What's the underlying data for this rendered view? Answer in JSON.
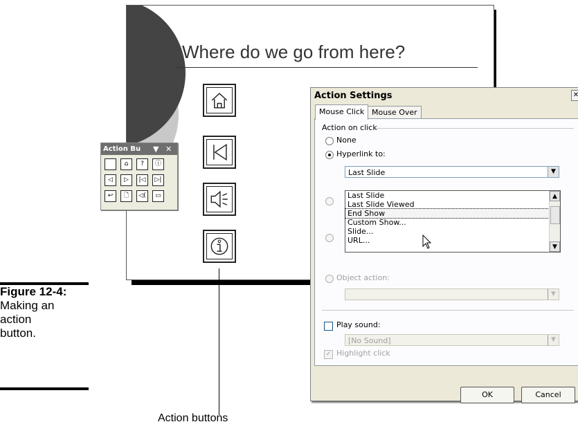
{
  "figure": {
    "number": "Figure 12-4:",
    "text": "Making an action button."
  },
  "slide": {
    "title": "Where do we go from here?",
    "buttons": [
      "home-icon",
      "beginning-icon",
      "sound-icon",
      "information-icon"
    ]
  },
  "callout": {
    "label": "Action buttons"
  },
  "toolbar": {
    "title": "Action Bu",
    "menu_glyph": "▼",
    "close_glyph": "✕",
    "buttons": [
      {
        "name": "custom-button-icon",
        "glyph": ""
      },
      {
        "name": "home-button-icon",
        "glyph": "⌂"
      },
      {
        "name": "help-button-icon",
        "glyph": "?"
      },
      {
        "name": "information-button-icon",
        "glyph": "ⓘ"
      },
      {
        "name": "back-button-icon",
        "glyph": "◁"
      },
      {
        "name": "forward-button-icon",
        "glyph": "▷"
      },
      {
        "name": "beginning-button-icon",
        "glyph": "|◁"
      },
      {
        "name": "end-button-icon",
        "glyph": "▷|"
      },
      {
        "name": "return-button-icon",
        "glyph": "↩"
      },
      {
        "name": "document-button-icon",
        "glyph": "🗋"
      },
      {
        "name": "sound-button-icon",
        "glyph": "◁("
      },
      {
        "name": "movie-button-icon",
        "glyph": "▭"
      }
    ]
  },
  "dialog": {
    "title": "Action Settings",
    "close_glyph": "✕",
    "tabs": [
      "Mouse Click",
      "Mouse Over"
    ],
    "group_label": "Action on click",
    "options": {
      "none": "None",
      "hyperlink": "Hyperlink to:",
      "object_action": "Object action:"
    },
    "hyperlink_value": "Last Slide",
    "dropdown_list": [
      "Last Slide",
      "Last Slide Viewed",
      "End Show",
      "Custom Show...",
      "Slide...",
      "URL..."
    ],
    "selected_item": "End Show",
    "play_sound": "Play sound:",
    "sound_value": "[No Sound]",
    "highlight_click": "Highlight click",
    "ok": "OK",
    "cancel": "Cancel"
  }
}
